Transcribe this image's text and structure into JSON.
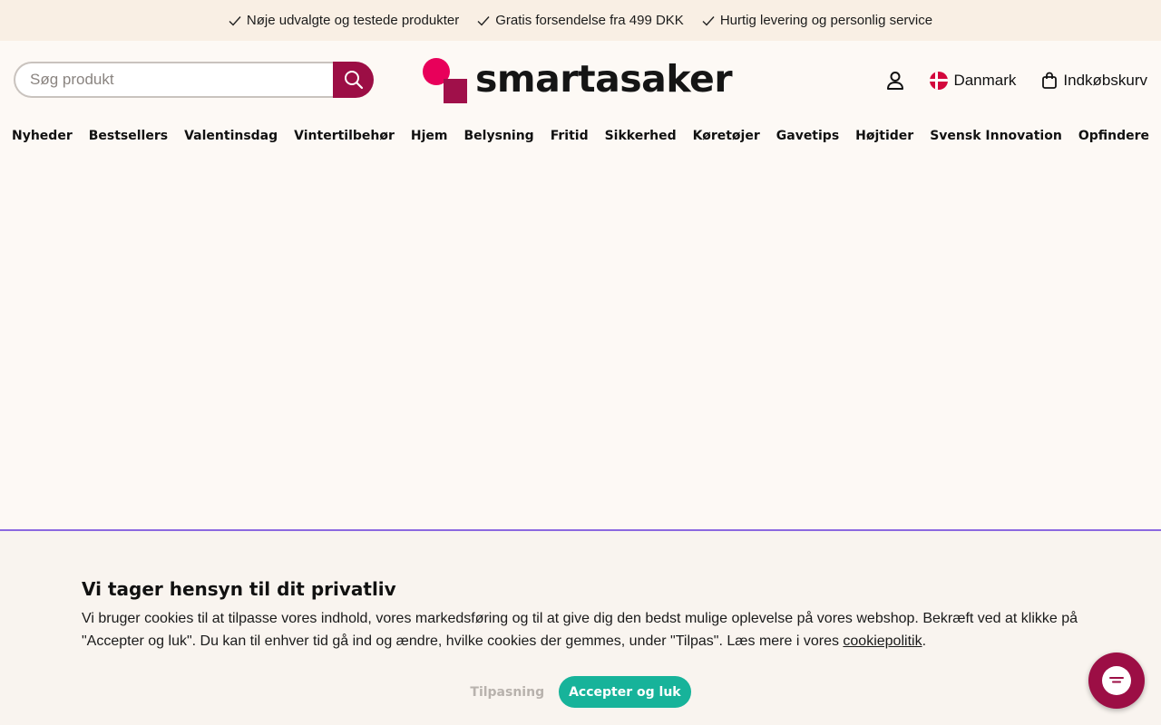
{
  "usp": {
    "items": [
      "Nøje udvalgte og testede produkter",
      "Gratis forsendelse fra 499 DKK",
      "Hurtig levering og personlig service"
    ]
  },
  "search": {
    "placeholder": "Søg produkt",
    "value": ""
  },
  "logo": {
    "text": "smartasaker"
  },
  "header": {
    "country": "Danmark",
    "cart": "Indkøbskurv"
  },
  "nav": [
    "Nyheder",
    "Bestsellers",
    "Valentinsdag",
    "Vintertilbehør",
    "Hjem",
    "Belysning",
    "Fritid",
    "Sikkerhed",
    "Køretøjer",
    "Gavetips",
    "Højtider",
    "Svensk Innovation",
    "Opfindere"
  ],
  "cookie": {
    "title": "Vi tager hensyn til dit privatliv",
    "text_before_link": "Vi bruger cookies til at tilpasse vores indhold, vores markedsføring og til at give dig den bedst mulige oplevelse på vores webshop. Bekræft ved at klikke på \"Accepter og luk\". Du kan til enhver tid gå ind og ændre, hvilke cookies der gemmes, under \"Tilpas\". Læs mere i vores ",
    "link": "cookiepolitik",
    "text_after_link": ".",
    "customize_label": "Tilpasning",
    "accept_label": "Accepter og luk"
  },
  "colors": {
    "brand": "#9c0e45",
    "brand_pink": "#e8005a",
    "accept": "#17b39a",
    "usp_bg": "#f9efe4",
    "page_bg": "#fdf9f5"
  },
  "icons": {
    "check": "check-icon",
    "search": "search-icon",
    "account": "user-icon",
    "flag": "denmark-flag-icon",
    "cart": "shopping-bag-icon",
    "chat": "chat-icon"
  }
}
